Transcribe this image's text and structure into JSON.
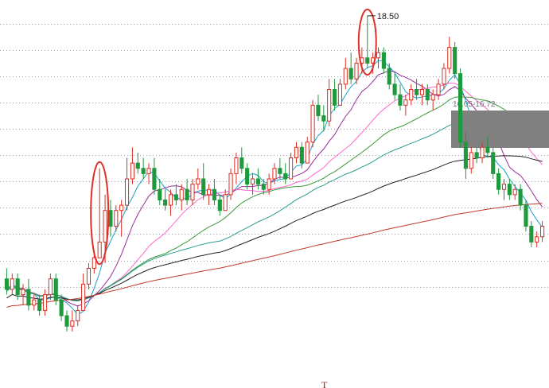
{
  "chart_data": {
    "type": "candlestick",
    "title": "",
    "xlabel": "",
    "ylabel": "",
    "grid": true,
    "colors": {
      "up": "#d93025",
      "down": "#1e9a3c",
      "bg": "#ffffff",
      "grid": "#9aa0a6"
    },
    "candles": [
      [
        13.5,
        13.7,
        13.2,
        13.3
      ],
      [
        13.3,
        13.6,
        13.2,
        13.5
      ],
      [
        13.5,
        13.6,
        13.1,
        13.2
      ],
      [
        13.2,
        13.4,
        13.0,
        13.3
      ],
      [
        13.3,
        13.5,
        12.9,
        13.0
      ],
      [
        13.0,
        13.2,
        12.9,
        13.1
      ],
      [
        13.1,
        13.2,
        12.8,
        12.9
      ],
      [
        12.9,
        13.3,
        12.8,
        13.2
      ],
      [
        13.2,
        13.6,
        13.1,
        13.5
      ],
      [
        13.5,
        13.6,
        13.0,
        13.1
      ],
      [
        13.1,
        13.2,
        12.7,
        12.8
      ],
      [
        12.8,
        12.9,
        12.5,
        12.6
      ],
      [
        12.6,
        12.9,
        12.5,
        12.7
      ],
      [
        12.7,
        13.0,
        12.6,
        12.9
      ],
      [
        12.9,
        13.6,
        12.9,
        13.4
      ],
      [
        13.4,
        13.8,
        13.3,
        13.7
      ],
      [
        13.7,
        14.0,
        13.6,
        13.9
      ],
      [
        13.9,
        15.6,
        13.9,
        14.2
      ],
      [
        14.2,
        15.1,
        13.8,
        14.8
      ],
      [
        14.8,
        15.0,
        14.3,
        14.5
      ],
      [
        14.5,
        14.9,
        14.4,
        14.8
      ],
      [
        14.8,
        15.0,
        14.3,
        14.9
      ],
      [
        14.9,
        15.8,
        14.8,
        15.4
      ],
      [
        15.4,
        16.0,
        15.3,
        15.7
      ],
      [
        15.7,
        15.9,
        15.5,
        15.6
      ],
      [
        15.6,
        15.8,
        15.4,
        15.5
      ],
      [
        15.5,
        15.7,
        15.3,
        15.6
      ],
      [
        15.6,
        15.8,
        15.1,
        15.2
      ],
      [
        15.2,
        15.4,
        14.9,
        15.0
      ],
      [
        15.0,
        15.2,
        14.8,
        14.9
      ],
      [
        14.9,
        15.2,
        14.7,
        15.1
      ],
      [
        15.1,
        15.3,
        14.9,
        15.0
      ],
      [
        15.0,
        15.3,
        14.8,
        15.2
      ],
      [
        15.2,
        15.4,
        14.9,
        15.0
      ],
      [
        15.0,
        15.4,
        14.9,
        15.3
      ],
      [
        15.3,
        15.6,
        15.2,
        15.4
      ],
      [
        15.4,
        15.7,
        15.0,
        15.1
      ],
      [
        15.1,
        15.3,
        14.9,
        15.2
      ],
      [
        15.2,
        15.4,
        14.9,
        15.0
      ],
      [
        15.0,
        15.1,
        14.7,
        14.8
      ],
      [
        14.8,
        15.2,
        14.8,
        15.1
      ],
      [
        15.1,
        15.6,
        15.0,
        15.5
      ],
      [
        15.5,
        15.9,
        15.3,
        15.8
      ],
      [
        15.8,
        16.0,
        15.5,
        15.6
      ],
      [
        15.6,
        15.7,
        15.2,
        15.3
      ],
      [
        15.3,
        15.5,
        15.1,
        15.4
      ],
      [
        15.4,
        15.6,
        15.2,
        15.3
      ],
      [
        15.3,
        15.4,
        15.1,
        15.2
      ],
      [
        15.2,
        15.5,
        15.1,
        15.4
      ],
      [
        15.4,
        15.7,
        15.3,
        15.6
      ],
      [
        15.6,
        15.8,
        15.4,
        15.5
      ],
      [
        15.5,
        15.7,
        15.3,
        15.4
      ],
      [
        15.4,
        15.9,
        15.4,
        15.8
      ],
      [
        15.8,
        16.1,
        15.7,
        16.0
      ],
      [
        16.0,
        16.1,
        15.6,
        15.7
      ],
      [
        15.7,
        16.2,
        15.7,
        16.1
      ],
      [
        16.1,
        16.9,
        16.0,
        16.8
      ],
      [
        16.8,
        17.0,
        16.5,
        16.6
      ],
      [
        16.6,
        16.8,
        16.3,
        16.5
      ],
      [
        16.5,
        17.3,
        16.4,
        17.1
      ],
      [
        17.1,
        17.3,
        16.7,
        16.8
      ],
      [
        16.8,
        17.3,
        16.8,
        17.2
      ],
      [
        17.2,
        17.7,
        17.1,
        17.5
      ],
      [
        17.5,
        17.8,
        17.2,
        17.3
      ],
      [
        17.3,
        17.7,
        17.2,
        17.6
      ],
      [
        17.6,
        17.9,
        17.4,
        17.7
      ],
      [
        17.7,
        18.5,
        17.5,
        17.6
      ],
      [
        17.6,
        17.8,
        17.4,
        17.7
      ],
      [
        17.7,
        17.9,
        17.5,
        17.8
      ],
      [
        17.8,
        17.9,
        17.4,
        17.5
      ],
      [
        17.5,
        17.6,
        17.1,
        17.2
      ],
      [
        17.2,
        17.4,
        16.9,
        17.0
      ],
      [
        17.0,
        17.2,
        16.7,
        16.8
      ],
      [
        16.8,
        17.0,
        16.6,
        16.9
      ],
      [
        16.9,
        17.2,
        16.8,
        17.1
      ],
      [
        17.1,
        17.3,
        16.9,
        17.0
      ],
      [
        17.0,
        17.2,
        16.8,
        17.1
      ],
      [
        17.1,
        17.2,
        16.8,
        16.9
      ],
      [
        16.9,
        17.1,
        16.7,
        17.0
      ],
      [
        17.0,
        17.3,
        16.9,
        17.2
      ],
      [
        17.2,
        17.6,
        17.1,
        17.5
      ],
      [
        17.5,
        18.1,
        17.4,
        17.9
      ],
      [
        17.9,
        18.0,
        17.3,
        17.4
      ],
      [
        17.4,
        17.5,
        16.0,
        16.1
      ],
      [
        16.1,
        16.3,
        15.4,
        15.6
      ],
      [
        15.6,
        16.0,
        15.5,
        15.9
      ],
      [
        15.9,
        16.0,
        15.7,
        15.8
      ],
      [
        15.8,
        16.1,
        15.7,
        16.0
      ],
      [
        16.0,
        16.2,
        15.8,
        15.9
      ],
      [
        15.9,
        16.0,
        15.4,
        15.5
      ],
      [
        15.5,
        15.6,
        15.1,
        15.2
      ],
      [
        15.2,
        15.4,
        15.0,
        15.3
      ],
      [
        15.3,
        15.4,
        15.0,
        15.1
      ],
      [
        15.1,
        15.3,
        15.0,
        15.2
      ],
      [
        15.2,
        15.3,
        14.8,
        14.9
      ],
      [
        14.9,
        15.0,
        14.4,
        14.5
      ],
      [
        14.5,
        14.6,
        14.1,
        14.2
      ],
      [
        14.2,
        14.4,
        14.1,
        14.3
      ],
      [
        14.3,
        14.6,
        14.2,
        14.5
      ]
    ],
    "peak_annotation": {
      "index": 66,
      "label": "18.50"
    },
    "box_label": "16.05-16.72",
    "highlight_circles": [
      17,
      66
    ],
    "grid_values": [
      18.35,
      17.85,
      17.35,
      16.85,
      16.35,
      15.85,
      15.35,
      14.85,
      14.35,
      13.85,
      13.35
    ],
    "moving_averages": [
      {
        "color": "#17a2c8",
        "period": 5
      },
      {
        "color": "#9b2d9b",
        "period": 10
      },
      {
        "color": "#ff66cc",
        "period": 20
      },
      {
        "color": "#3a9a3a",
        "period": 30
      },
      {
        "color": "#2a9d8f",
        "period": 60
      },
      {
        "color": "#222222",
        "period": 120
      },
      {
        "color": "#c0392b",
        "period": 250
      }
    ],
    "y_range": [
      12.0,
      18.8
    ],
    "footer_mark": "T"
  }
}
